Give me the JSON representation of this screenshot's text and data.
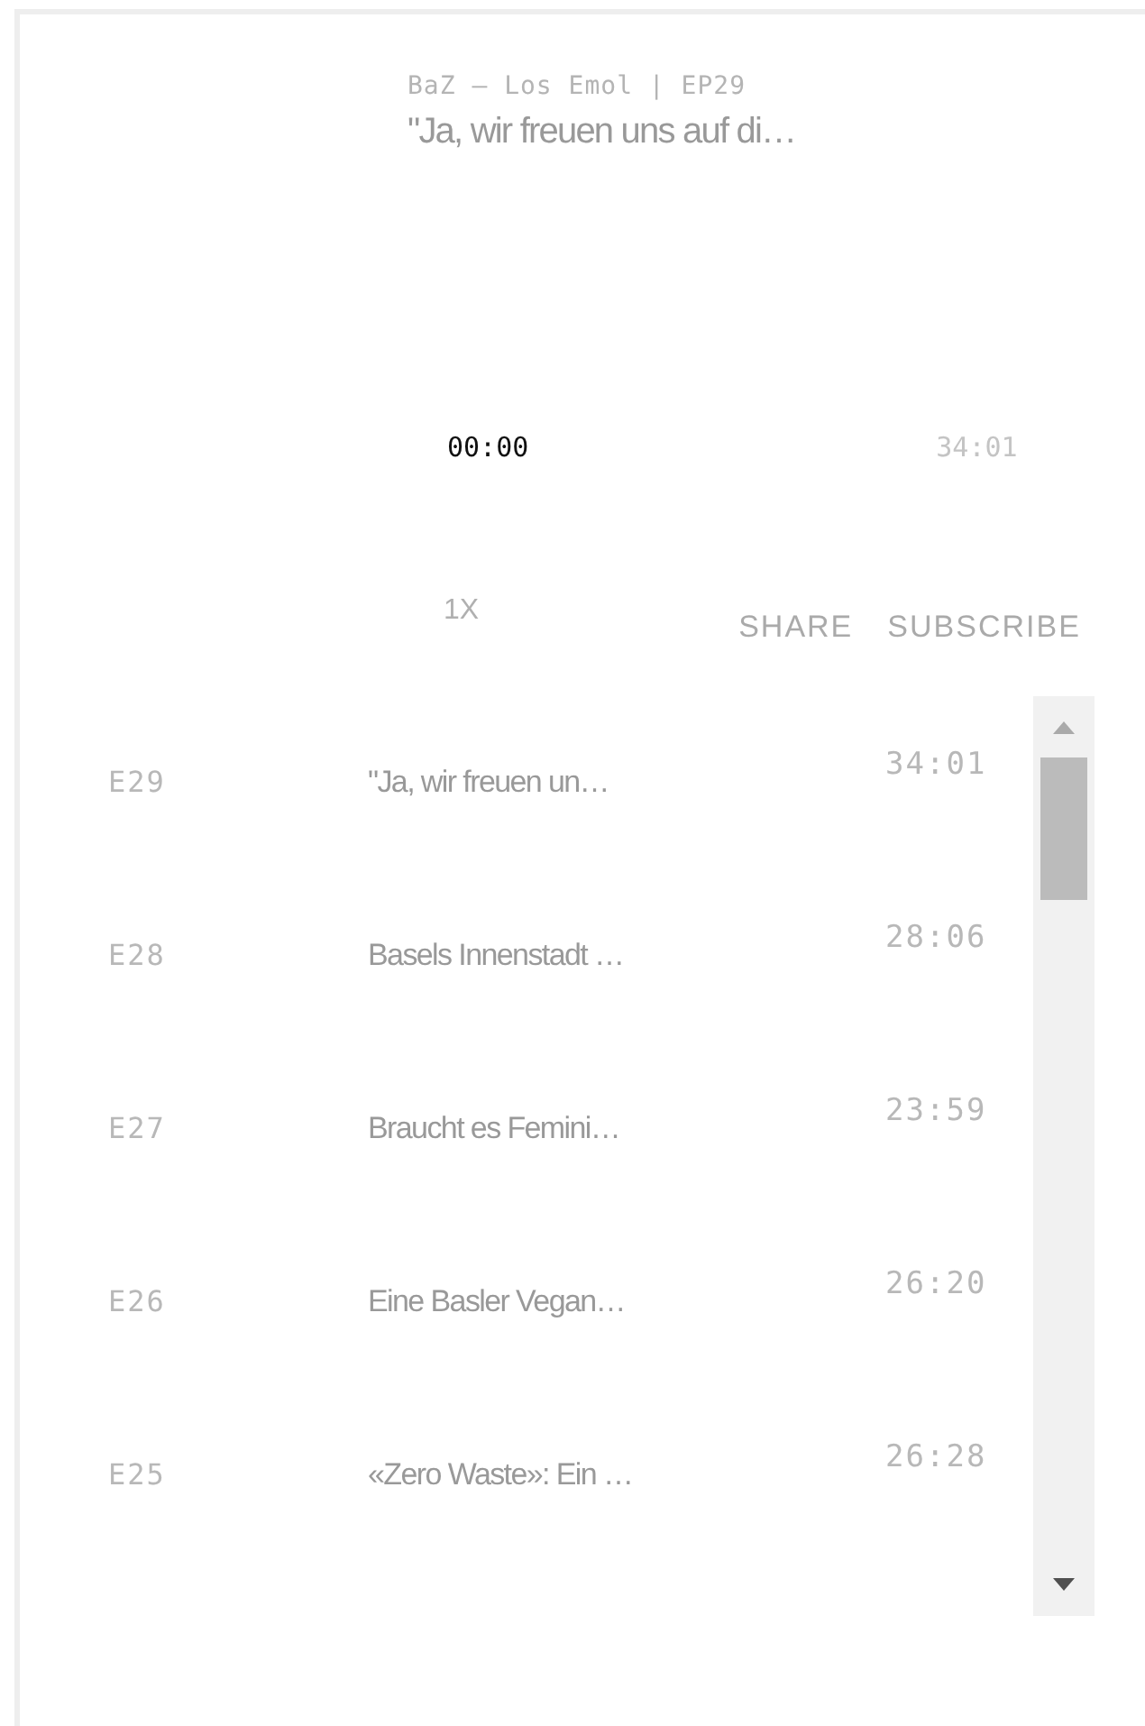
{
  "player": {
    "series": "BaZ – Los Emol | EP29",
    "title": "\"Ja, wir freuen uns auf di…",
    "current_time": "00:00",
    "duration": "34:01",
    "speed": "1X",
    "share": "SHARE",
    "subscribe": "SUBSCRIBE"
  },
  "episodes": [
    {
      "number": "E29",
      "title": "\"Ja, wir freuen un…",
      "duration": "34:01"
    },
    {
      "number": "E28",
      "title": "Basels Innenstadt …",
      "duration": "28:06"
    },
    {
      "number": "E27",
      "title": "Braucht es Femini…",
      "duration": "23:59"
    },
    {
      "number": "E26",
      "title": "Eine Basler Vegan…",
      "duration": "26:20"
    },
    {
      "number": "E25",
      "title": "«Zero Waste»: Ein …",
      "duration": "26:28"
    }
  ]
}
